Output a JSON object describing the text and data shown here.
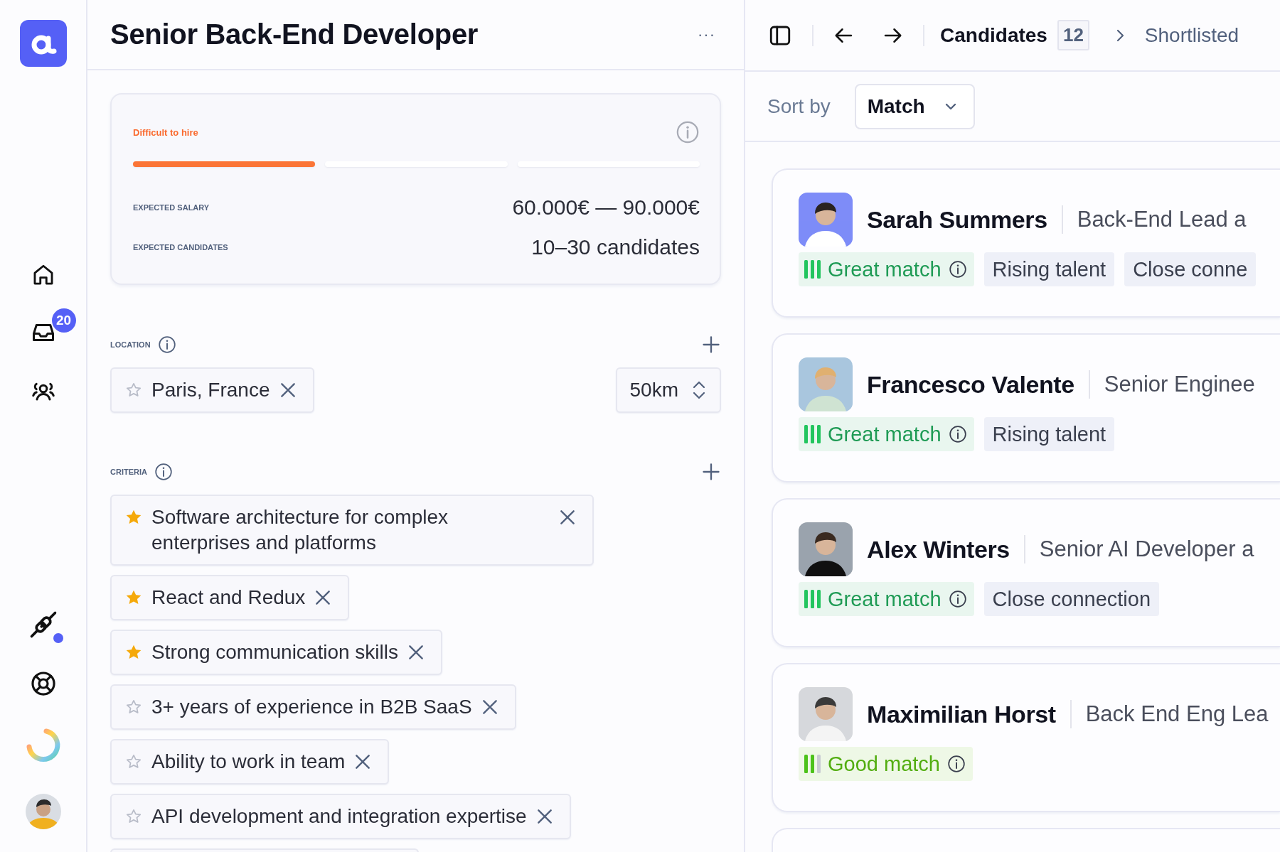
{
  "rail": {
    "badge": "20",
    "plugin_alert": true
  },
  "job": {
    "title": "Senior Back-End Developer",
    "menu": "···",
    "difficulty": {
      "label": "Difficult to hire",
      "level": 0.33
    },
    "stats": [
      {
        "label": "EXPECTED SALARY",
        "value": "60.000€ — 90.000€"
      },
      {
        "label": "EXPECTED CANDIDATES",
        "value": "10–30 candidates"
      }
    ],
    "location": {
      "label": "LOCATION",
      "place": "Paris, France",
      "starred": false,
      "radius": "50km"
    },
    "criteria": {
      "label": "CRITERIA",
      "items": [
        {
          "text": "Software architecture for complex enterprises and platforms",
          "starred": true
        },
        {
          "text": "React and Redux",
          "starred": true
        },
        {
          "text": "Strong communication skills",
          "starred": true
        },
        {
          "text": "3+ years of experience in B2B SaaS",
          "starred": false
        },
        {
          "text": "Ability to work in team",
          "starred": false
        },
        {
          "text": "API development and integration expertise",
          "starred": false
        }
      ]
    }
  },
  "candidates": {
    "breadcrumb": "Candidates",
    "count": "12",
    "stage": "Shortlisted",
    "sort_label": "Sort by",
    "sort_value": "Match",
    "items": [
      {
        "name": "Sarah Summers",
        "role": "Back-End Lead a",
        "match": {
          "kind": "great",
          "label": "Great match"
        },
        "tags": [
          "Rising talent",
          "Close conne"
        ]
      },
      {
        "name": "Francesco Valente",
        "role": "Senior Enginee",
        "match": {
          "kind": "great",
          "label": "Great match"
        },
        "tags": [
          "Rising talent"
        ]
      },
      {
        "name": "Alex Winters",
        "role": "Senior AI Developer a",
        "match": {
          "kind": "great",
          "label": "Great match"
        },
        "tags": [
          "Close connection"
        ]
      },
      {
        "name": "Maximilian Horst",
        "role": "Back End Eng Lea",
        "match": {
          "kind": "good",
          "label": "Good match"
        }
      }
    ]
  }
}
